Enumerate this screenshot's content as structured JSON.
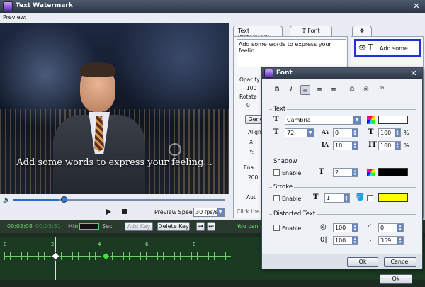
{
  "window": {
    "title": "Text Watermark",
    "close": "✕"
  },
  "preview": {
    "label": "Preview:",
    "watermark_text": "Add some words to express your feeling...",
    "progress": 0.22
  },
  "controls": {
    "speed_label": "Preview Speed:",
    "speed_value": "30 fps/s"
  },
  "tabs": {
    "text_watermark": "Text Watermark",
    "font": "Font"
  },
  "text_panel": {
    "text_value": "Add some words to express your feelin",
    "opacity_label": "Opacity",
    "opacity_value": "100",
    "rotate_label": "Rotate",
    "rotate_value": "0",
    "general_btn": "Gene",
    "align_label": "Aligne",
    "x_label": "X:",
    "y_label": "Y:",
    "enable_label": "Ena",
    "num_value": "200",
    "auto_label": "Aut",
    "click_hint": "Click the 'A"
  },
  "layer_panel": {
    "item_label": "Add some ..."
  },
  "timeline": {
    "current_time": "00:02:08",
    "total_time": "00:03:51",
    "min_label": "Min.",
    "sec_label": "Sec.",
    "add_key": "Add Key",
    "delete_key": "Delete Key",
    "hint": "You can p",
    "ticks": [
      "0",
      "2",
      "4",
      "6",
      "8"
    ],
    "ok": "Ok"
  },
  "font_dialog": {
    "title": "Font",
    "close": "✕",
    "format_buttons": [
      "B",
      "I",
      "≡",
      "≡",
      "≡",
      "©",
      "®",
      "™"
    ],
    "text_group": "Text",
    "font_name": "Cambria",
    "font_size": "72",
    "spacing": "0",
    "line_height": "10",
    "scale_h": "100",
    "scale_v": "100",
    "percent": "%",
    "text_color": "#ffffff",
    "shadow_group": "Shadow",
    "shadow_enable": "Enable",
    "shadow_value": "2",
    "shadow_color": "#000000",
    "stroke_group": "Stroke",
    "stroke_enable": "Enable",
    "stroke_value": "1",
    "stroke_color": "#ffff00",
    "distort_group": "Distorted Text",
    "distort_enable": "Enable",
    "distort_a": "100",
    "distort_b": "0",
    "distort_c": "100",
    "distort_d": "359",
    "ok": "Ok",
    "cancel": "Cancel"
  }
}
